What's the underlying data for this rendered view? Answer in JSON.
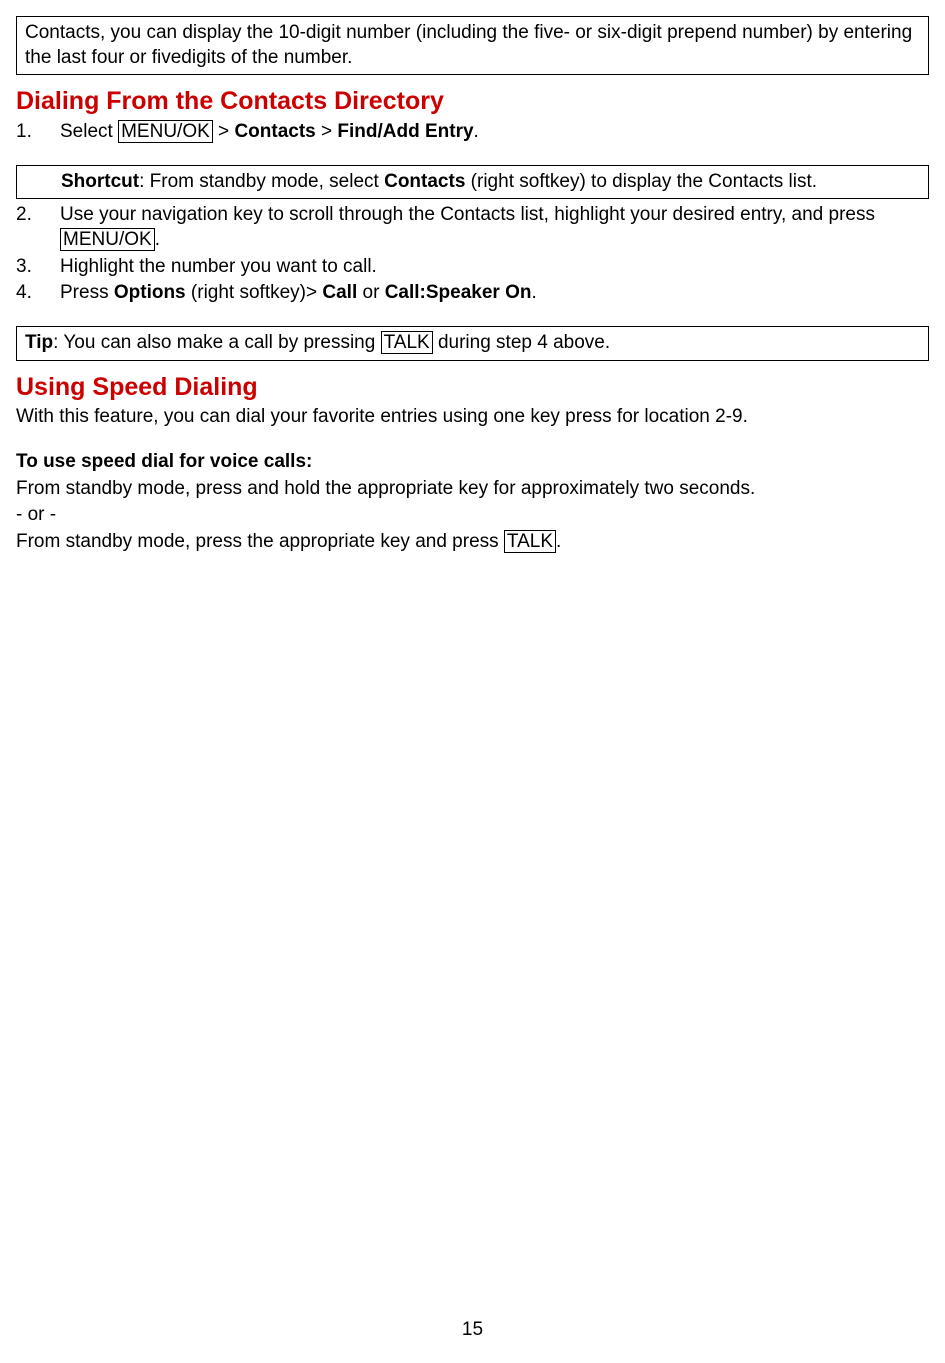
{
  "topbox": "Contacts, you can display the 10-digit number (including the five- or six-digit prepend number) by entering the last four or fivedigits of the number.",
  "heading1": "Dialing From the Contacts Directory",
  "step1": {
    "num": "1.",
    "pre": "Select ",
    "key": "MENU/OK",
    "mid": " > ",
    "b1": "Contacts",
    "mid2": " > ",
    "b2": "Find/Add Entry",
    "post": "."
  },
  "shortcut": {
    "label": "Shortcut",
    "pre": ": From standby mode, select ",
    "bold": "Contacts",
    "post": " (right softkey) to display the Contacts list."
  },
  "step2": {
    "num": "2.",
    "pre": "Use your navigation key to scroll through the Contacts list, highlight your desired entry, and press ",
    "key": "MENU/OK",
    "post": "."
  },
  "step3": {
    "num": "3.",
    "text": "Highlight the number you want to call."
  },
  "step4": {
    "num": "4.",
    "pre": "Press ",
    "b1": "Options",
    "mid": " (right softkey)> ",
    "b2": "Call",
    "mid2": " or ",
    "b3": "Call:Speaker On",
    "post": "."
  },
  "tipbox": {
    "label": "Tip",
    "pre": ": You can also make a call by pressing ",
    "key": "TALK",
    "post": " during step 4 above."
  },
  "heading2": "Using Speed Dialing",
  "speed_intro": "With this feature, you can dial your favorite entries using one key press for location 2-9.",
  "speed_sub": "To use speed dial for voice calls:",
  "speed_line1": "From standby mode, press and hold the appropriate key for approximately two seconds.",
  "speed_or": "- or -",
  "speed_line2_pre": "From standby mode, press the appropriate key and press ",
  "speed_line2_key": "TALK",
  "speed_line2_post": ".",
  "pagenum": "15"
}
